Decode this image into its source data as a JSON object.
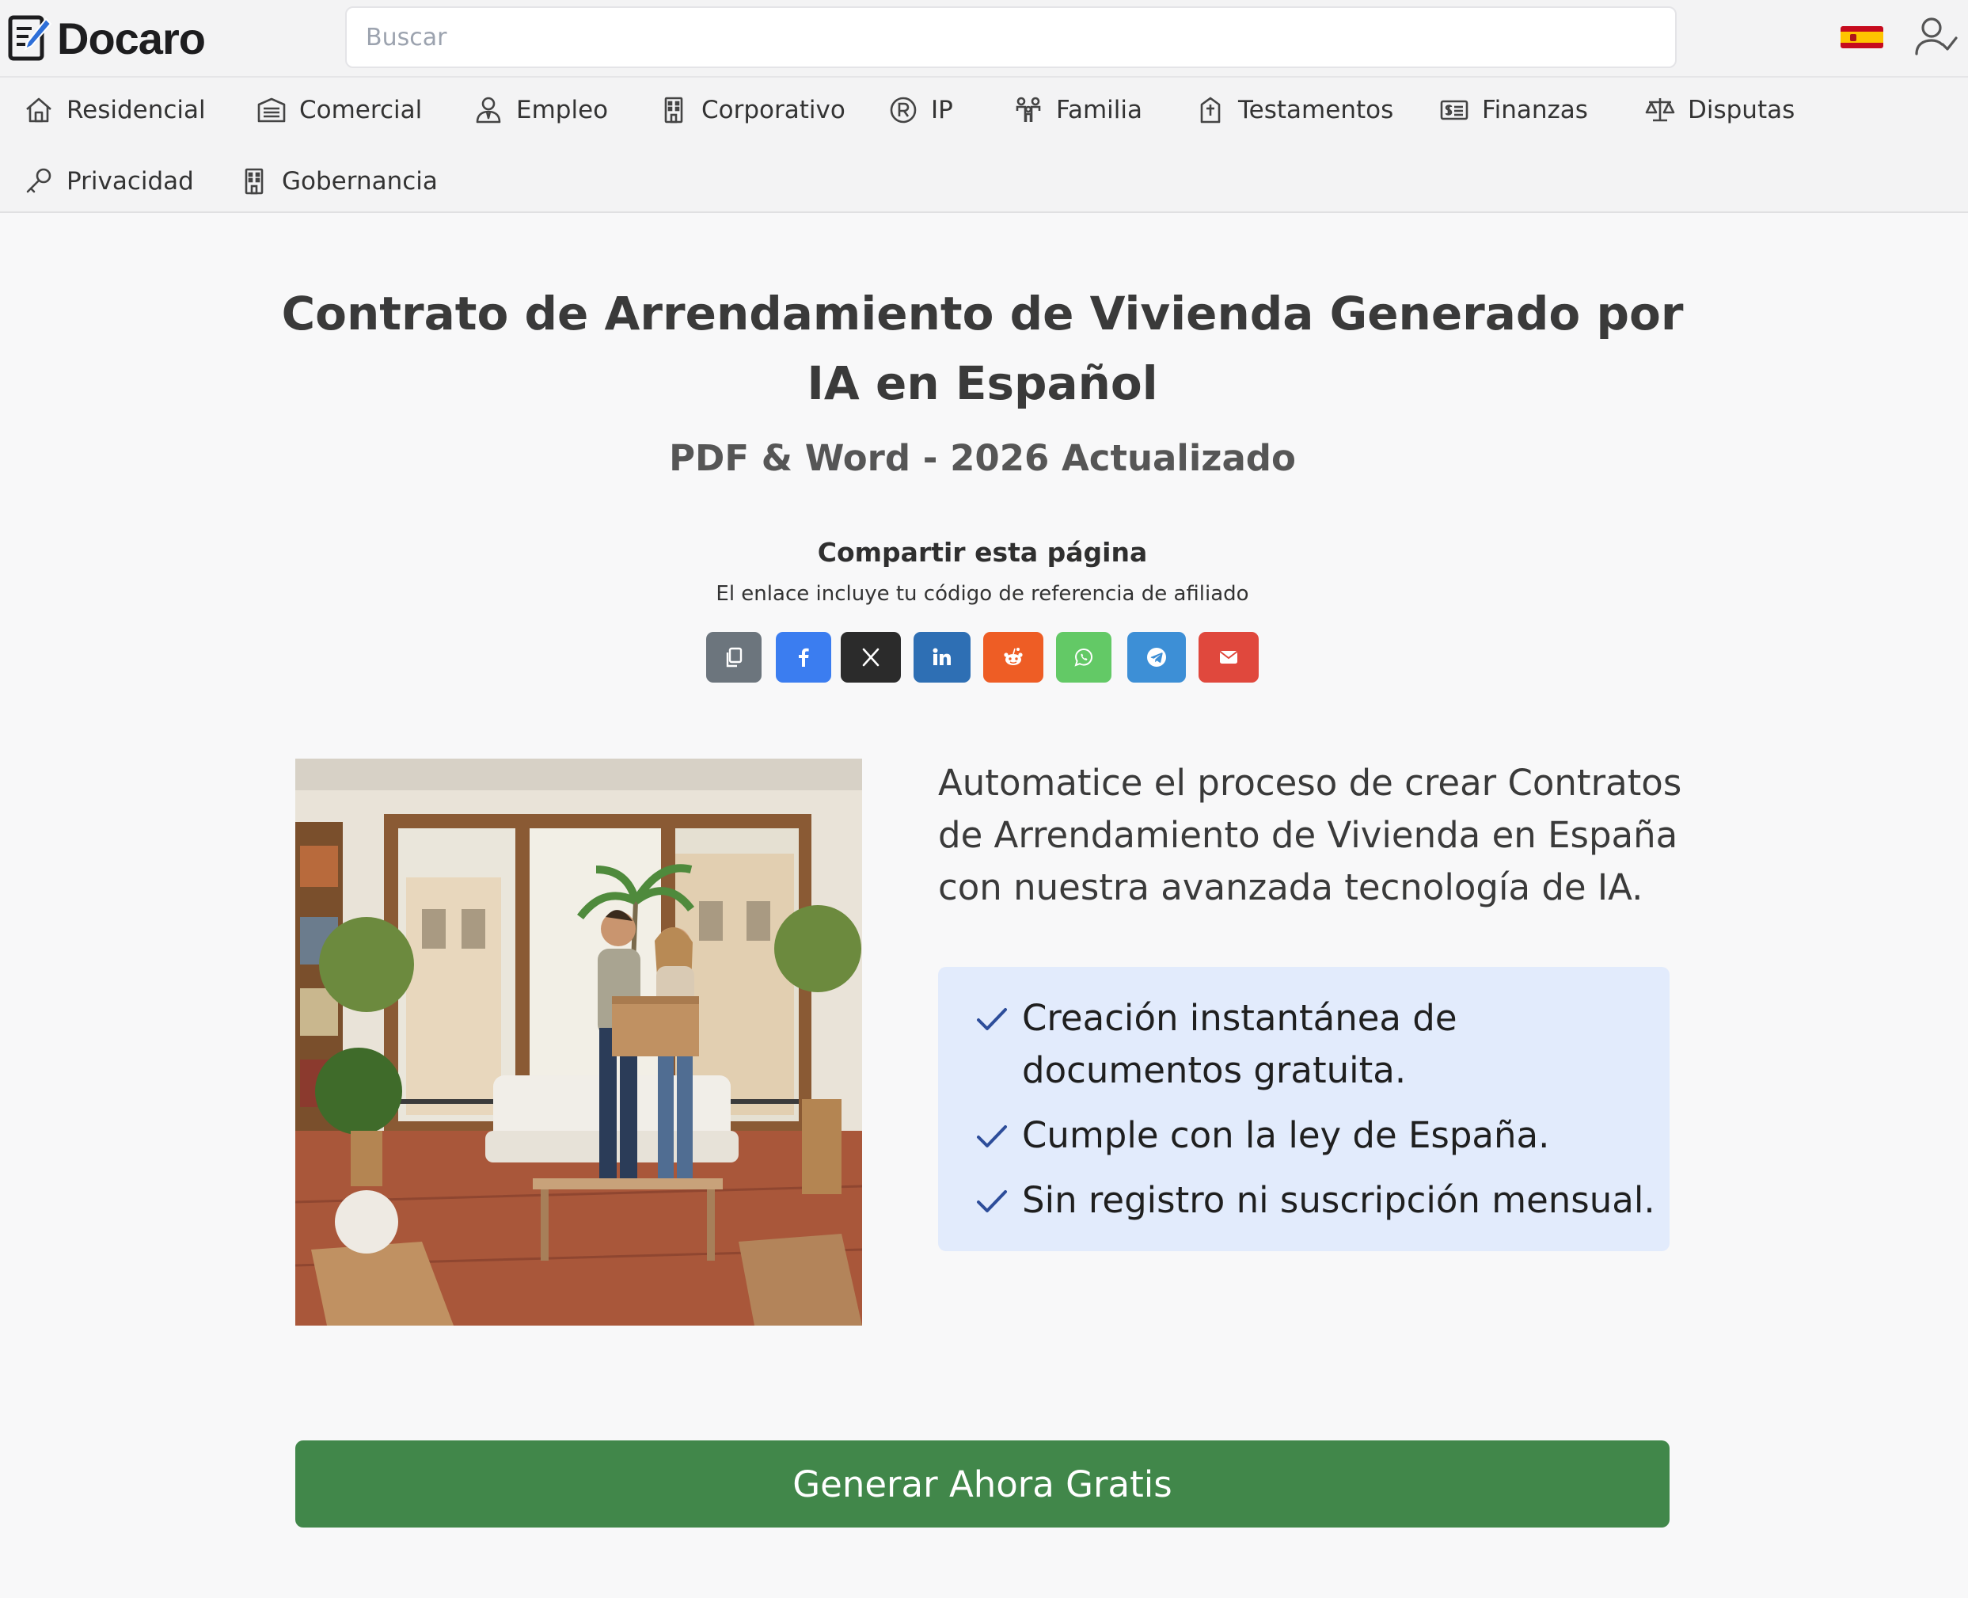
{
  "header": {
    "logo_text": "Docaro",
    "search_placeholder": "Buscar",
    "language_flag": "spain-flag-icon",
    "account_icon": "user-check-icon"
  },
  "categories": [
    {
      "label": "Residencial",
      "icon": "house-icon"
    },
    {
      "label": "Comercial",
      "icon": "garage-icon"
    },
    {
      "label": "Empleo",
      "icon": "worker-icon"
    },
    {
      "label": "Corporativo",
      "icon": "building-icon"
    },
    {
      "label": "IP",
      "icon": "registered-icon"
    },
    {
      "label": "Familia",
      "icon": "family-icon"
    },
    {
      "label": "Testamentos",
      "icon": "will-icon"
    },
    {
      "label": "Finanzas",
      "icon": "finance-card-icon"
    },
    {
      "label": "Disputas",
      "icon": "scales-icon"
    },
    {
      "label": "Privacidad",
      "icon": "key-icon"
    },
    {
      "label": "Gobernancia",
      "icon": "building-icon"
    }
  ],
  "main": {
    "title": "Contrato de Arrendamiento de Vivienda Generado por IA en Español",
    "subtitle": "PDF & Word - 2026 Actualizado",
    "share": {
      "title": "Compartir esta página",
      "subtitle": "El enlace incluye tu código de referencia de afiliado",
      "buttons": [
        {
          "name": "copy-link",
          "icon": "copy-icon",
          "color": "#6c757d"
        },
        {
          "name": "facebook",
          "icon": "facebook-icon",
          "color": "#3b7df0"
        },
        {
          "name": "x",
          "icon": "x-icon",
          "color": "#2b2b2b"
        },
        {
          "name": "linkedin",
          "icon": "linkedin-icon",
          "color": "#2e6fb4"
        },
        {
          "name": "reddit",
          "icon": "reddit-icon",
          "color": "#ee5d25"
        },
        {
          "name": "whatsapp",
          "icon": "whatsapp-icon",
          "color": "#63c966"
        },
        {
          "name": "telegram",
          "icon": "telegram-icon",
          "color": "#3d8fd6"
        },
        {
          "name": "email",
          "icon": "mail-icon",
          "color": "#e0483d"
        }
      ]
    },
    "intro": "Automatice el proceso de crear Contratos de Arrendamiento de Vivienda en España con nuestra avanzada tecnología de IA.",
    "features": [
      "Creación instantánea de documentos gratuita.",
      "Cumple con la ley de España.",
      "Sin registro ni suscripción mensual."
    ],
    "cta_label": "Generar Ahora Gratis"
  },
  "colors": {
    "accent_green": "#41874a",
    "feature_bg": "#e2ebfc",
    "check_color": "#2d4d9a"
  }
}
